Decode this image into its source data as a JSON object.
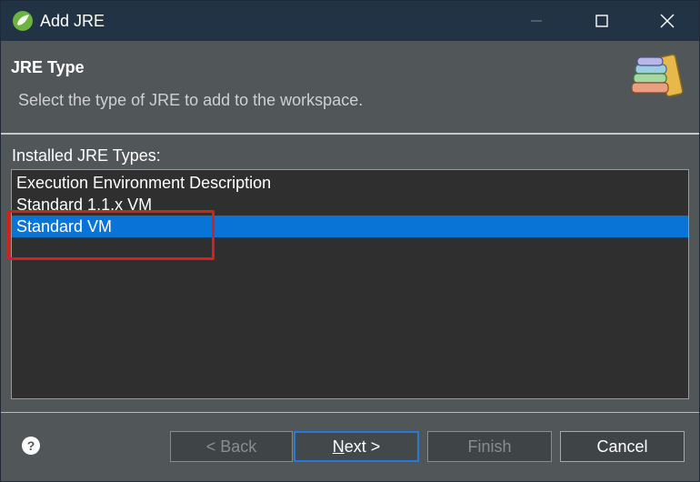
{
  "window": {
    "title": "Add JRE"
  },
  "header": {
    "title": "JRE Type",
    "description": "Select the type of JRE to add to the workspace."
  },
  "body": {
    "label": "Installed JRE Types:",
    "items": [
      {
        "label": "Execution Environment Description",
        "selected": false
      },
      {
        "label": "Standard 1.1.x VM",
        "selected": false
      },
      {
        "label": "Standard VM",
        "selected": true
      }
    ]
  },
  "footer": {
    "back_label": "< Back",
    "next_label": "Next >",
    "finish_label": "Finish",
    "cancel_label": "Cancel"
  },
  "colors": {
    "titlebar": "#213344",
    "background": "#515658",
    "list_background": "#2f2f2f",
    "selection": "#0a74d6",
    "highlight_box": "#d0231f"
  },
  "icons": {
    "app": "eclipse-spring-icon",
    "header": "library-books-icon",
    "help": "help-icon"
  }
}
